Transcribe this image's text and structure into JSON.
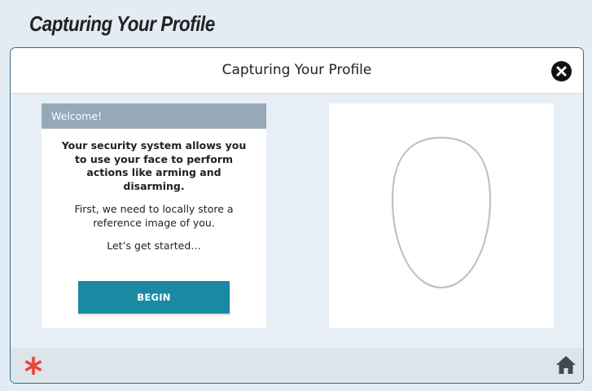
{
  "page": {
    "heading": "Capturing Your Profile"
  },
  "window": {
    "title": "Capturing Your Profile",
    "close_icon": "close-icon"
  },
  "welcome": {
    "header": "Welcome!",
    "bold_text": "Your security system allows you to use your face to perform actions like arming and disarming.",
    "paragraph_2": "First, we need to locally store a reference image of you.",
    "paragraph_3": "Let’s get started…",
    "begin_label": "BEGIN"
  },
  "camera": {
    "face_outline_icon": "face-outline-icon"
  },
  "footer": {
    "logo_icon": "asterisk-logo-icon",
    "home_icon": "home-icon"
  },
  "colors": {
    "accent": "#1a8aa2",
    "header_bar": "#95a9b9",
    "logo": "#e8453c",
    "background": "#e3ebf4"
  }
}
